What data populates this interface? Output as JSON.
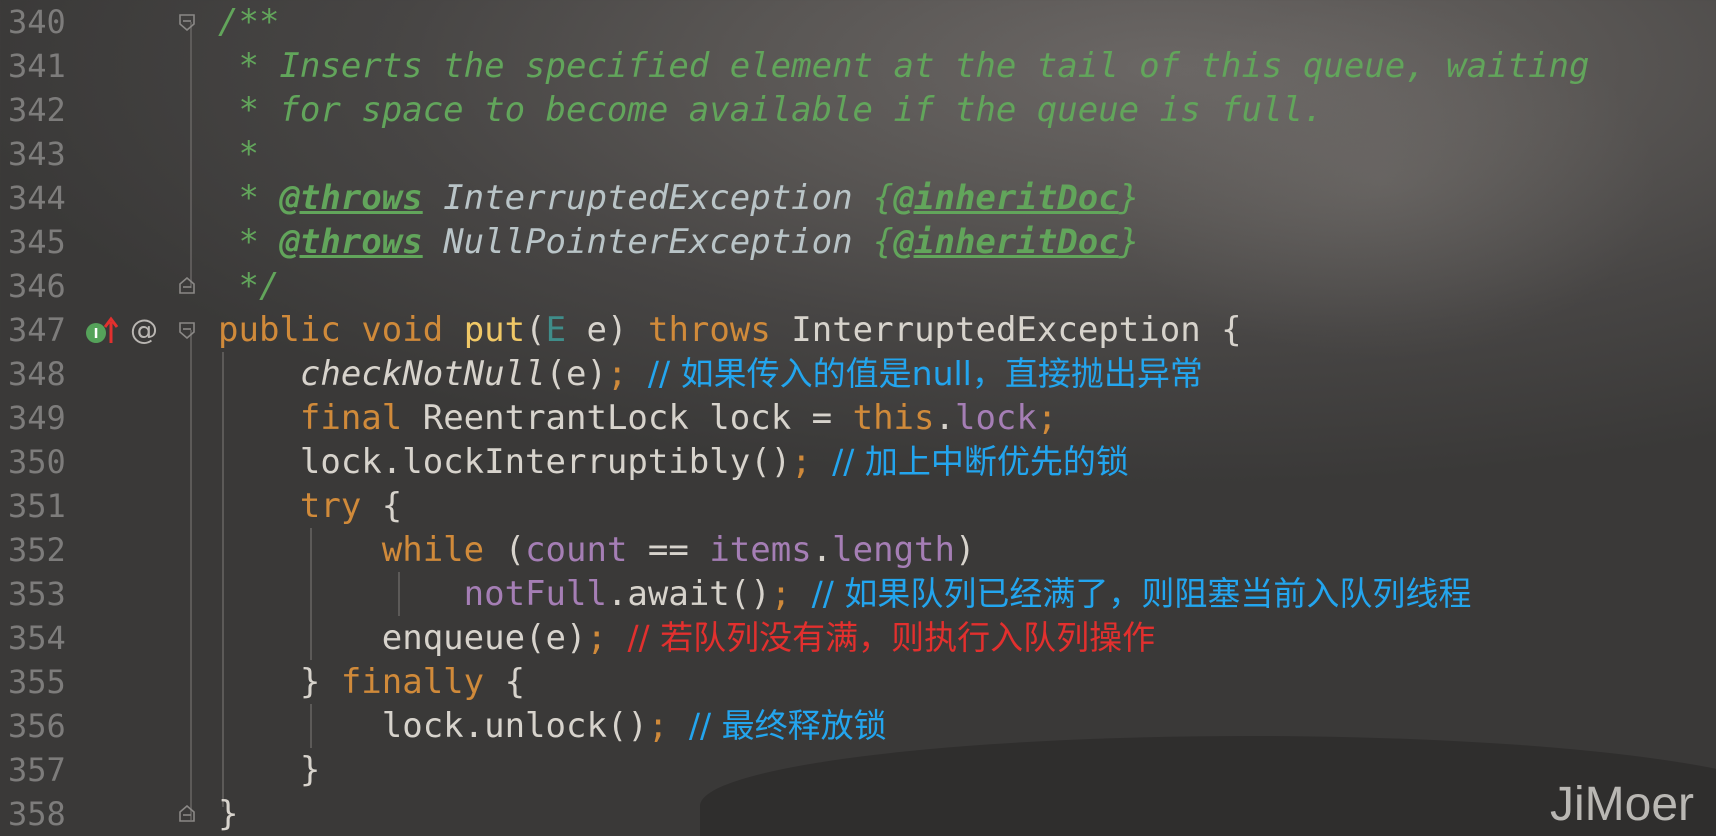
{
  "editor": {
    "lines": [
      {
        "num": "340",
        "t": [
          "/**"
        ]
      },
      {
        "num": "341",
        "t": [
          " * Inserts the specified element at the tail of this queue, waiting"
        ]
      },
      {
        "num": "342",
        "t": [
          " * for space to become available if the queue is full."
        ]
      },
      {
        "num": "343",
        "t": [
          " *"
        ]
      },
      {
        "num": "344",
        "t": [
          " * ",
          "@throws",
          " InterruptedException ",
          "{",
          "@inheritDoc",
          "}"
        ]
      },
      {
        "num": "345",
        "t": [
          " * ",
          "@throws",
          " NullPointerException ",
          "{",
          "@inheritDoc",
          "}"
        ]
      },
      {
        "num": "346",
        "t": [
          " */"
        ]
      },
      {
        "num": "347",
        "t": [
          "public",
          " ",
          "void",
          " ",
          "put",
          "(",
          "E",
          " e) ",
          "throws",
          " InterruptedException {"
        ]
      },
      {
        "num": "348",
        "t": [
          "    ",
          "checkNotNull",
          "(e)",
          ";",
          " ",
          "// 如果传入的值是null，直接抛出异常"
        ]
      },
      {
        "num": "349",
        "t": [
          "    ",
          "final",
          " ReentrantLock lock = ",
          "this",
          ".",
          "lock",
          ";"
        ]
      },
      {
        "num": "350",
        "t": [
          "    lock.lockInterruptibly()",
          ";",
          " ",
          "// 加上中断优先的锁"
        ]
      },
      {
        "num": "351",
        "t": [
          "    ",
          "try",
          " {"
        ]
      },
      {
        "num": "352",
        "t": [
          "        ",
          "while",
          " (",
          "count",
          " == ",
          "items",
          ".",
          "length",
          ")"
        ]
      },
      {
        "num": "353",
        "t": [
          "            ",
          "notFull",
          ".await()",
          ";",
          " ",
          "// 如果队列已经满了，则阻塞当前入队列线程"
        ]
      },
      {
        "num": "354",
        "t": [
          "        enqueue(e)",
          ";",
          " ",
          "// 若队列没有满，则执行入队列操作"
        ]
      },
      {
        "num": "355",
        "t": [
          "    } ",
          "finally",
          " {"
        ]
      },
      {
        "num": "356",
        "t": [
          "        lock.unlock()",
          ";",
          " ",
          "// 最终释放锁"
        ]
      },
      {
        "num": "357",
        "t": [
          "    }"
        ]
      },
      {
        "num": "358",
        "t": [
          "}"
        ]
      }
    ]
  },
  "watermark": "JiMoer",
  "colors": {
    "keyword": "#d08a3a",
    "comment": "#62a55b",
    "field": "#a57eb5",
    "method": "#f0c866",
    "annotation_blue": "#23a5ee",
    "annotation_red": "#e2302e"
  },
  "gutter_icons": [
    "implements-method-icon",
    "annotation-at-icon"
  ]
}
